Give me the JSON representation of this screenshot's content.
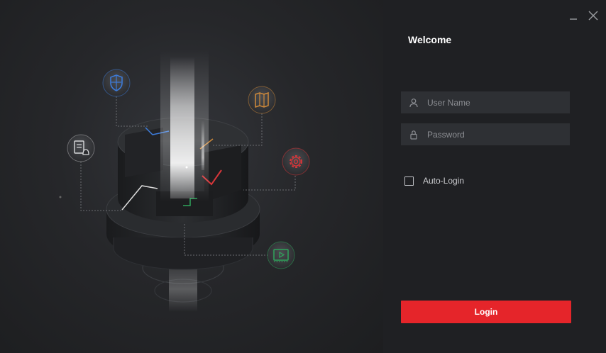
{
  "window": {
    "minimize_icon": "minimize-icon",
    "close_icon": "close-icon"
  },
  "login_panel": {
    "welcome": "Welcome",
    "username": {
      "placeholder": "User Name",
      "value": "",
      "icon": "user-icon"
    },
    "password": {
      "placeholder": "Password",
      "value": "",
      "icon": "lock-icon"
    },
    "auto_login": {
      "label": "Auto-Login",
      "checked": false
    },
    "login_button": "Login"
  },
  "illustration": {
    "icons": [
      "shield-icon",
      "map-icon",
      "settings-gear-icon",
      "document-alarm-icon",
      "video-playback-icon"
    ]
  },
  "colors": {
    "accent": "#e5252a",
    "background": "#1f2023",
    "field_bg": "#2e3034",
    "shield": "#3d7bd9",
    "map": "#d08a3a",
    "gear": "#d8363a",
    "video": "#2fa55c"
  }
}
